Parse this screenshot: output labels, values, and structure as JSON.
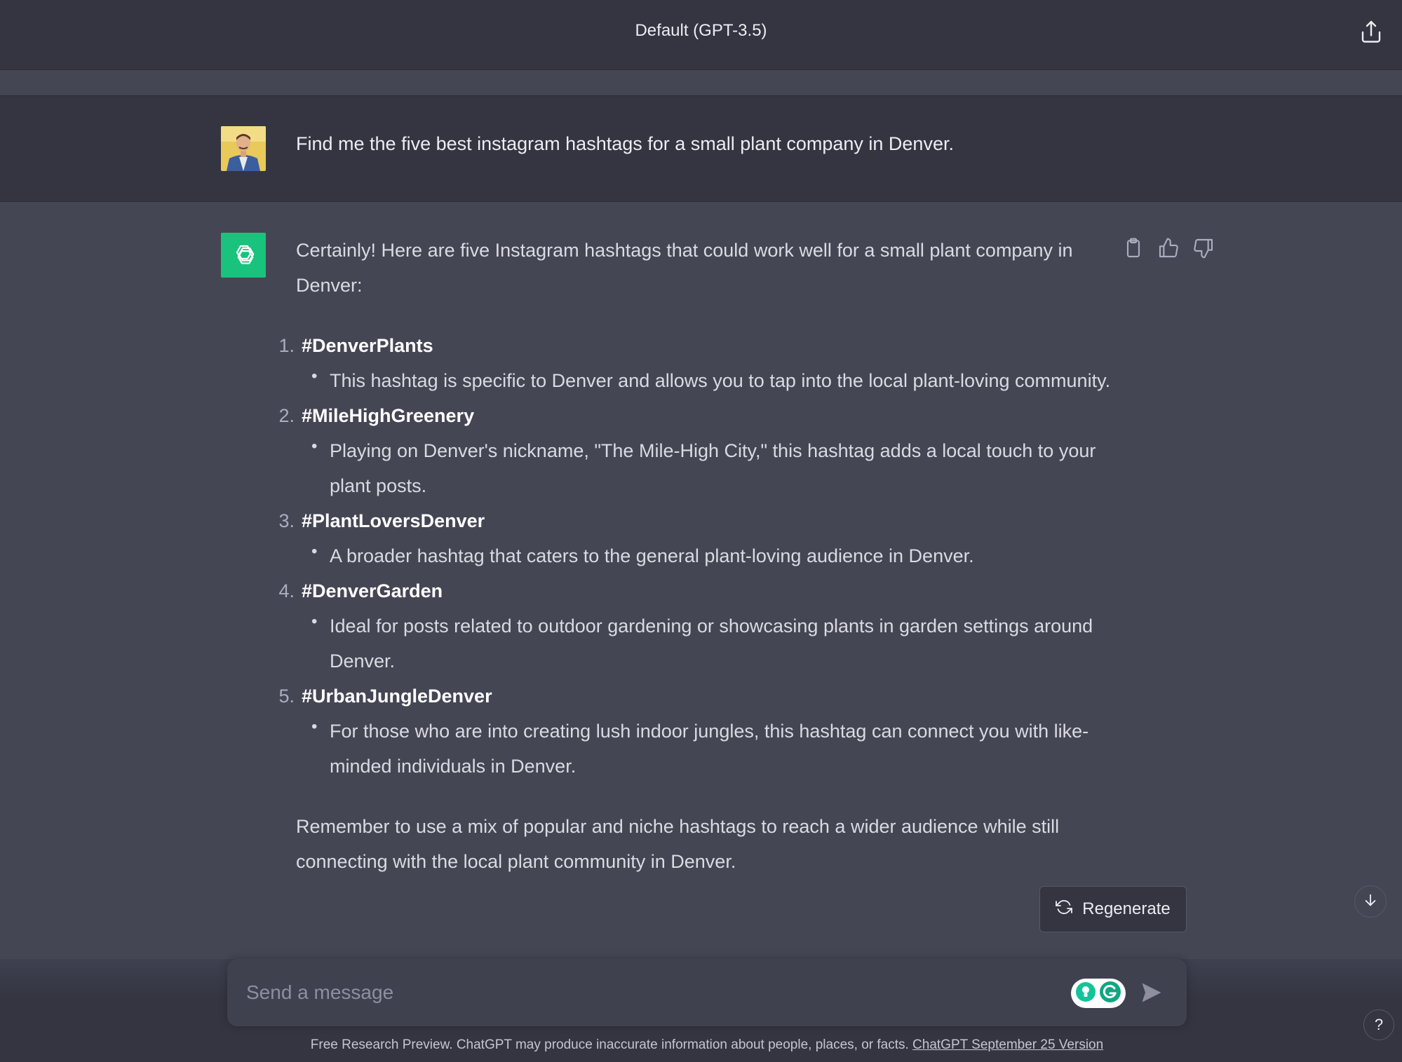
{
  "header": {
    "title": "Default (GPT-3.5)",
    "share_icon": "share-icon"
  },
  "user_message": {
    "text": "Find me the five best instagram hashtags for a small plant company in Denver."
  },
  "assistant_message": {
    "intro": "Certainly! Here are five Instagram hashtags that could work well for a small plant company in Denver:",
    "items": [
      {
        "number": "1.",
        "hashtag": "#DenverPlants",
        "description": "This hashtag is specific to Denver and allows you to tap into the local plant-loving community."
      },
      {
        "number": "2.",
        "hashtag": "#MileHighGreenery",
        "description": "Playing on Denver's nickname, \"The Mile-High City,\" this hashtag adds a local touch to your plant posts."
      },
      {
        "number": "3.",
        "hashtag": "#PlantLoversDenver",
        "description": "A broader hashtag that caters to the general plant-loving audience in Denver."
      },
      {
        "number": "4.",
        "hashtag": "#DenverGarden",
        "description": "Ideal for posts related to outdoor gardening or showcasing plants in garden settings around Denver."
      },
      {
        "number": "5.",
        "hashtag": "#UrbanJungleDenver",
        "description": "For those who are into creating lush indoor jungles, this hashtag can connect you with like-minded individuals in Denver."
      }
    ],
    "closing": "Remember to use a mix of popular and niche hashtags to reach a wider audience while still connecting with the local plant community in Denver."
  },
  "actions": {
    "regenerate_label": "Regenerate"
  },
  "composer": {
    "placeholder": "Send a message"
  },
  "footer": {
    "disclaimer": "Free Research Preview. ChatGPT may produce inaccurate information about people, places, or facts. ",
    "version_link": "ChatGPT September 25 Version",
    "help_label": "?"
  },
  "colors": {
    "background": "#444654",
    "header_bg": "#343541",
    "brand_green": "#19c37d",
    "input_bg": "#40414f"
  }
}
